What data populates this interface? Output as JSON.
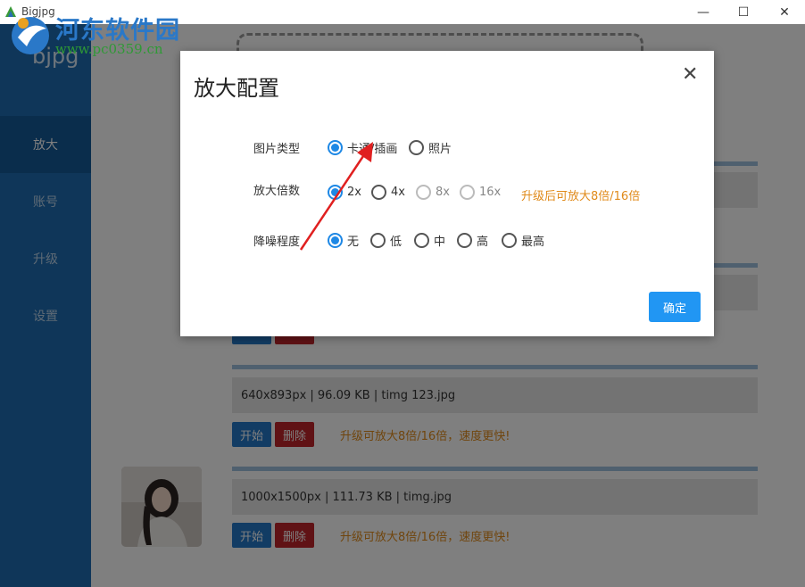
{
  "window": {
    "title": "Bigjpg",
    "minimize": "—",
    "maximize": "☐",
    "close": "✕"
  },
  "watermark": {
    "title": "河东软件园",
    "url": "www.pc0359.cn"
  },
  "sidebar": {
    "logo": "bjpg",
    "items": [
      {
        "label": "放大",
        "active": true
      },
      {
        "label": "账号",
        "active": false
      },
      {
        "label": "升级",
        "active": false
      },
      {
        "label": "设置",
        "active": false
      }
    ]
  },
  "files": [
    {
      "info": "640x893px | 96.09 KB | timg 123.jpg",
      "start_label": "开始",
      "delete_label": "删除",
      "promo": "升级可放大8倍/16倍，速度更快!"
    },
    {
      "info": "1000x1500px | 111.73 KB | timg.jpg",
      "start_label": "开始",
      "delete_label": "删除",
      "promo": "升级可放大8倍/16倍，速度更快!"
    }
  ],
  "dialog": {
    "title": "放大配置",
    "close_icon": "✕",
    "image_type": {
      "label": "图片类型",
      "options": [
        {
          "label": "卡通/插画",
          "checked": true
        },
        {
          "label": "照片",
          "checked": false
        }
      ]
    },
    "scale": {
      "label": "放大倍数",
      "options": [
        {
          "label": "2x",
          "checked": true,
          "disabled": false
        },
        {
          "label": "4x",
          "checked": false,
          "disabled": false
        },
        {
          "label": "8x",
          "checked": false,
          "disabled": true
        },
        {
          "label": "16x",
          "checked": false,
          "disabled": true
        }
      ],
      "upgrade_hint": "升级后可放大8倍/16倍"
    },
    "noise": {
      "label": "降噪程度",
      "options": [
        {
          "label": "无",
          "checked": true
        },
        {
          "label": "低",
          "checked": false
        },
        {
          "label": "中",
          "checked": false
        },
        {
          "label": "高",
          "checked": false
        },
        {
          "label": "最高",
          "checked": false
        }
      ]
    },
    "confirm_label": "确定"
  },
  "colors": {
    "sidebar": "#1e6db3",
    "accent": "#2196f3",
    "delete": "#c0242a",
    "promo": "#e08a1a",
    "annotation_arrow": "#e02020"
  }
}
